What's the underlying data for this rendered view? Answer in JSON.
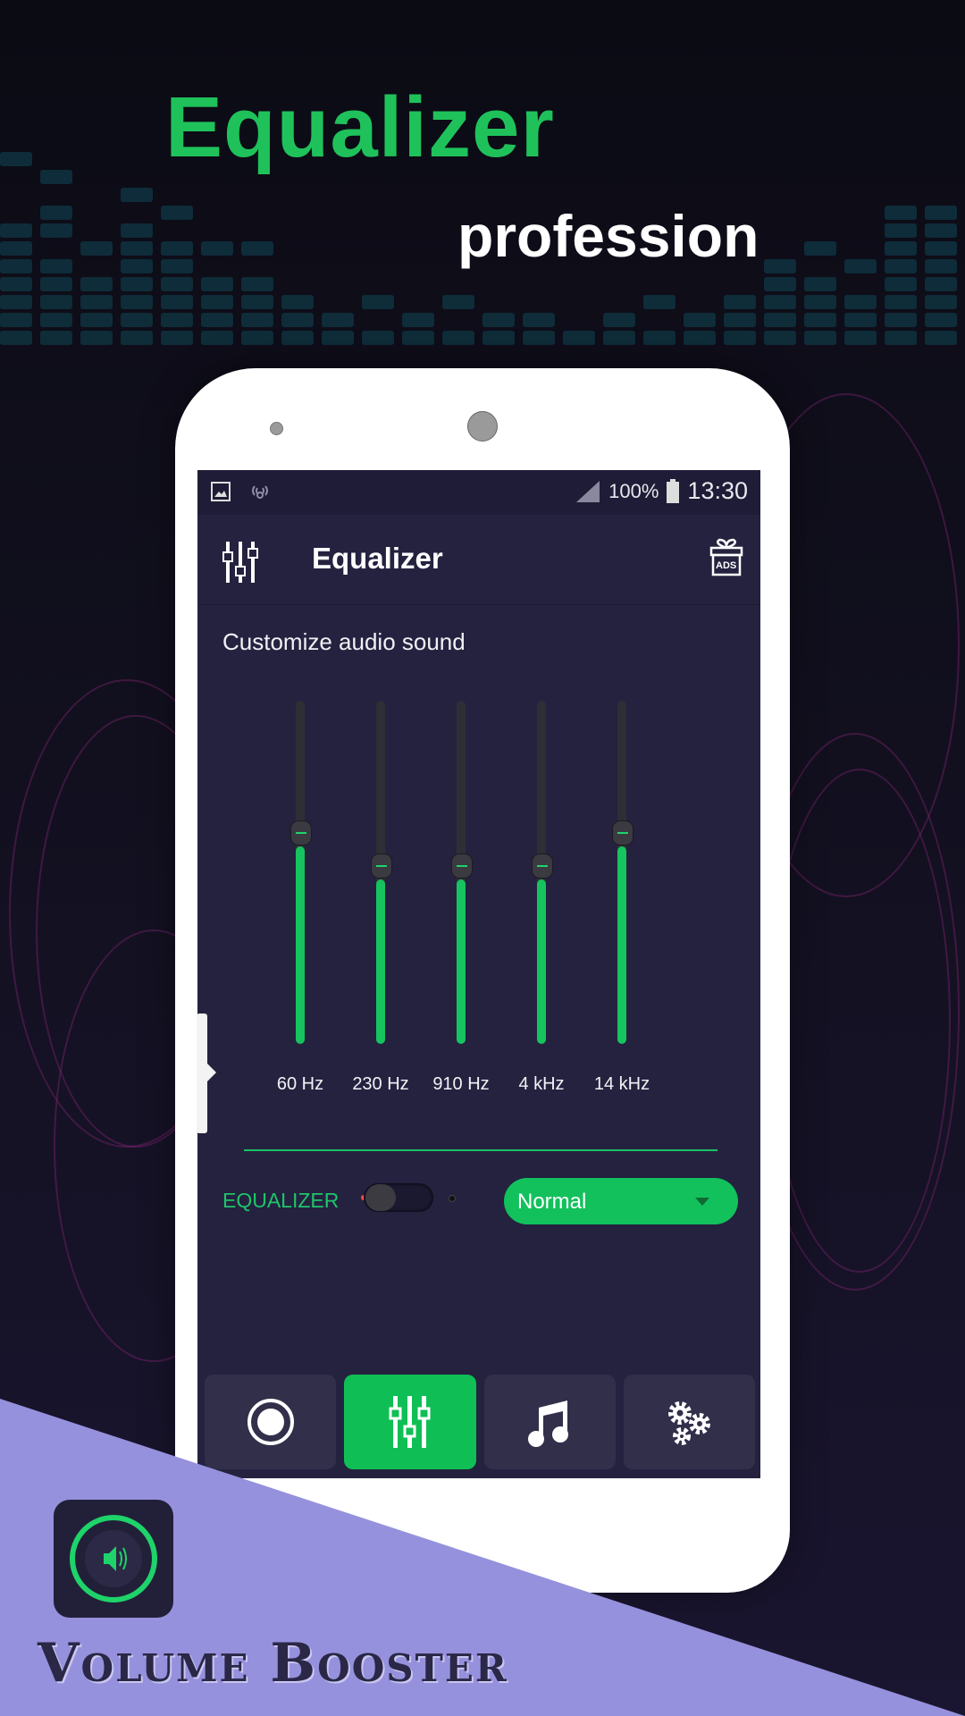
{
  "promo": {
    "headline": "Equalizer",
    "subheadline": "profession",
    "brand_name": "Volume Booster",
    "colors": {
      "accent": "#1fc25a",
      "promo_band": "#9591dc",
      "screen_bg": "#24223f"
    }
  },
  "statusbar": {
    "icons_left": [
      "image-icon",
      "hotspot-icon"
    ],
    "signal_icon": "signal-icon",
    "battery_percent": "100%",
    "battery_icon": "battery-icon",
    "time": "13:30"
  },
  "appbar": {
    "menu_icon": "sliders-icon",
    "title": "Equalizer",
    "ads_icon": "gift-ads-icon",
    "ads_label": "ADS"
  },
  "equalizer": {
    "subtitle": "Customize audio sound",
    "bands": [
      {
        "label": "60 Hz",
        "level": 0.6
      },
      {
        "label": "230 Hz",
        "level": 0.5
      },
      {
        "label": "910 Hz",
        "level": 0.5
      },
      {
        "label": "4 kHz",
        "level": 0.5
      },
      {
        "label": "14 kHz",
        "level": 0.6
      }
    ],
    "toggle_label": "EQUALIZER",
    "toggle_on": false,
    "preset_selected": "Normal"
  },
  "bottom_nav": [
    {
      "name": "volume",
      "icon": "record-circle-icon",
      "active": false
    },
    {
      "name": "equalizer",
      "icon": "sliders-icon",
      "active": true
    },
    {
      "name": "music",
      "icon": "music-note-icon",
      "active": false
    },
    {
      "name": "settings",
      "icon": "gears-icon",
      "active": false
    }
  ]
}
